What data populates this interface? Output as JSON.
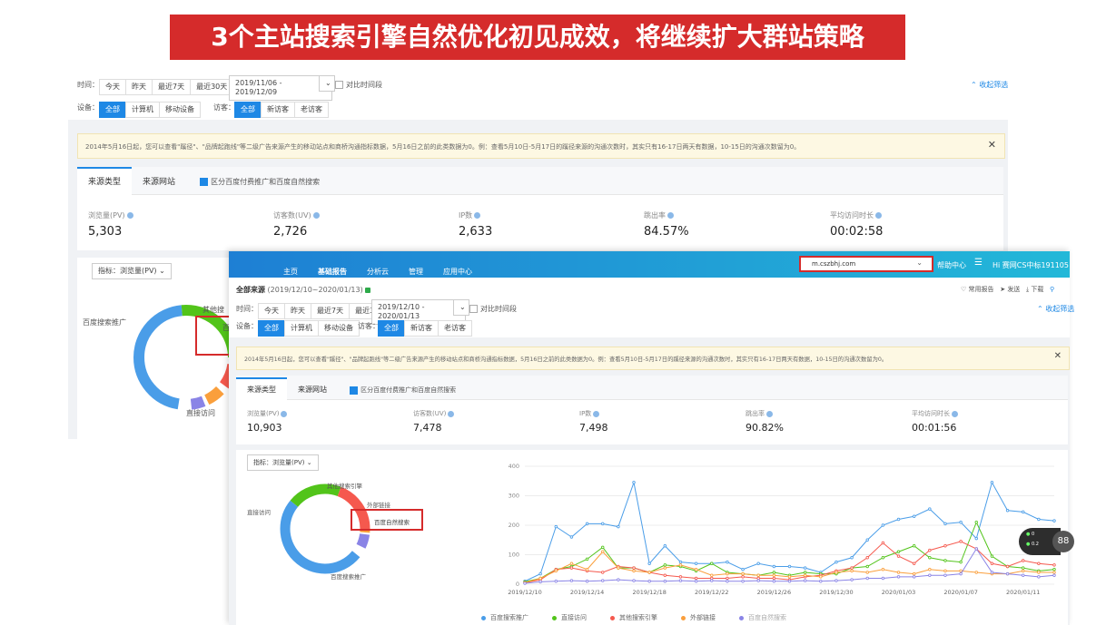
{
  "banner": {
    "title": "3个主站搜索引擎自然优化初见成效，将继续扩大群站策略"
  },
  "back": {
    "filters": {
      "time_label": "时间：",
      "time_options": [
        "今天",
        "昨天",
        "最近7天",
        "最近30天"
      ],
      "date_range": "2019/11/06 - 2019/12/09",
      "compare_label": "对比时间段",
      "collapse": "收起筛选",
      "device_label": "设备：",
      "device_options": [
        "全部",
        "计算机",
        "移动设备"
      ],
      "visitor_label": "访客：",
      "visitor_options": [
        "全部",
        "新访客",
        "老访客"
      ]
    },
    "notice": "2014年5月16日起，您可以查看\"蹊径\"、\"品牌起跑线\"等二级广告来源产生的移动站点和商桥沟通指标数据，5月16日之前的此类数据为0。例：查看5月10日-5月17日的蹊径来源的沟通次数时，其实只有16-17日两天有数据，10-15日的沟通次数留为0。",
    "tabs": [
      "来源类型",
      "来源网站"
    ],
    "checkbox_label": "区分百度付费推广和百度自然搜索",
    "metrics": [
      {
        "label": "浏览量(PV)",
        "value": "5,303"
      },
      {
        "label": "访客数(UV)",
        "value": "2,726"
      },
      {
        "label": "IP数",
        "value": "2,633"
      },
      {
        "label": "跳出率",
        "value": "84.57%"
      },
      {
        "label": "平均访问时长",
        "value": "00:02:58"
      }
    ],
    "indicator": "指标：浏览量(PV)",
    "donut_labels": {
      "other": "其他搜",
      "baidu_promo": "百度搜索推广",
      "direct": "直接访问",
      "baidu_natural": "百"
    }
  },
  "front": {
    "nav": {
      "items": [
        "主页",
        "基础报告",
        "分析云",
        "管理",
        "应用中心"
      ],
      "site": "m.cszbhj.com",
      "help": "帮助中心",
      "user": "Hi 赛网CS中标191105"
    },
    "subtitle": "全部来源",
    "subtitle_range": "(2019/12/10~2020/01/13)",
    "actions": [
      "常用报告",
      "发送",
      "下载"
    ],
    "filters": {
      "time_label": "时间：",
      "time_options": [
        "今天",
        "昨天",
        "最近7天",
        "最近30天"
      ],
      "date_range": "2019/12/10 - 2020/01/13",
      "compare_label": "对比时间段",
      "collapse": "收起筛选",
      "device_label": "设备：",
      "device_options": [
        "全部",
        "计算机",
        "移动设备"
      ],
      "visitor_label": "访客：",
      "visitor_options": [
        "全部",
        "新访客",
        "老访客"
      ]
    },
    "notice": "2014年5月16日起，您可以查看\"蹊径\"、\"品牌起跑线\"等二级广告来源产生的移动站点和商桥沟通指标数据，5月16日之前的此类数据为0。例：查看5月10日-5月17日的蹊径来源的沟通次数时，其实只有16-17日两天有数据，10-15日的沟通次数留为0。",
    "tabs": [
      "来源类型",
      "来源网站"
    ],
    "checkbox_label": "区分百度付费推广和百度自然搜索",
    "metrics": [
      {
        "label": "浏览量(PV)",
        "value": "10,903"
      },
      {
        "label": "访客数(UV)",
        "value": "7,478"
      },
      {
        "label": "IP数",
        "value": "7,498"
      },
      {
        "label": "跳出率",
        "value": "90.82%"
      },
      {
        "label": "平均访问时长",
        "value": "00:01:56"
      }
    ],
    "indicator": "指标：浏览量(PV)",
    "donut_labels": {
      "other": "其他搜索引擎",
      "external": "外部链接",
      "direct": "直接访问",
      "natural": "百度自然搜索",
      "promo": "百度搜索推广"
    },
    "widget": {
      "badge": "88",
      "l1": "0",
      "l2": "0.2"
    }
  },
  "chart_data": {
    "type": "line",
    "x": [
      "2019/12/10",
      "2019/12/11",
      "2019/12/12",
      "2019/12/13",
      "2019/12/14",
      "2019/12/15",
      "2019/12/16",
      "2019/12/17",
      "2019/12/18",
      "2019/12/19",
      "2019/12/20",
      "2019/12/21",
      "2019/12/22",
      "2019/12/23",
      "2019/12/24",
      "2019/12/25",
      "2019/12/26",
      "2019/12/27",
      "2019/12/28",
      "2019/12/29",
      "2019/12/30",
      "2019/12/31",
      "2020/01/01",
      "2020/01/02",
      "2020/01/03",
      "2020/01/04",
      "2020/01/05",
      "2020/01/06",
      "2020/01/07",
      "2020/01/08",
      "2020/01/09",
      "2020/01/10",
      "2020/01/11",
      "2020/01/12",
      "2020/01/13"
    ],
    "x_tick_labels": [
      "2019/12/10",
      "2019/12/14",
      "2019/12/18",
      "2019/12/22",
      "2019/12/26",
      "2019/12/30",
      "2020/01/03",
      "2020/01/07",
      "2020/01/11"
    ],
    "ylim": [
      0,
      400
    ],
    "y_ticks": [
      0,
      100,
      200,
      300,
      400
    ],
    "series": [
      {
        "name": "百度搜索推广",
        "color": "#4a9de8",
        "values": [
          10,
          35,
          195,
          160,
          205,
          205,
          195,
          345,
          70,
          130,
          75,
          70,
          70,
          75,
          50,
          70,
          60,
          60,
          55,
          40,
          75,
          90,
          150,
          200,
          220,
          230,
          255,
          205,
          210,
          155,
          345,
          250,
          245,
          220,
          215
        ]
      },
      {
        "name": "直接访问",
        "color": "#52c41a",
        "values": [
          8,
          20,
          50,
          60,
          85,
          125,
          55,
          55,
          40,
          65,
          60,
          45,
          70,
          40,
          35,
          30,
          40,
          30,
          40,
          35,
          35,
          55,
          60,
          90,
          110,
          130,
          90,
          80,
          75,
          210,
          95,
          60,
          55,
          45,
          50
        ]
      },
      {
        "name": "其他搜索引擎",
        "color": "#f5594e",
        "values": [
          5,
          15,
          50,
          55,
          45,
          40,
          60,
          55,
          40,
          30,
          25,
          20,
          20,
          20,
          25,
          20,
          20,
          15,
          25,
          30,
          45,
          55,
          90,
          140,
          95,
          70,
          115,
          130,
          145,
          120,
          70,
          60,
          80,
          70,
          65
        ]
      },
      {
        "name": "外部链接",
        "color": "#fa9f3c",
        "values": [
          5,
          20,
          45,
          70,
          50,
          110,
          55,
          45,
          40,
          55,
          65,
          50,
          30,
          35,
          35,
          30,
          30,
          25,
          30,
          25,
          40,
          45,
          40,
          50,
          40,
          35,
          50,
          45,
          45,
          40,
          35,
          35,
          45,
          40,
          40
        ]
      },
      {
        "name": "百度自然搜索",
        "color": "#8a84e6",
        "values": [
          3,
          8,
          10,
          12,
          10,
          12,
          15,
          12,
          10,
          10,
          12,
          10,
          12,
          10,
          10,
          12,
          10,
          10,
          12,
          10,
          12,
          15,
          20,
          20,
          25,
          25,
          30,
          30,
          35,
          120,
          40,
          35,
          30,
          25,
          30
        ]
      }
    ]
  }
}
